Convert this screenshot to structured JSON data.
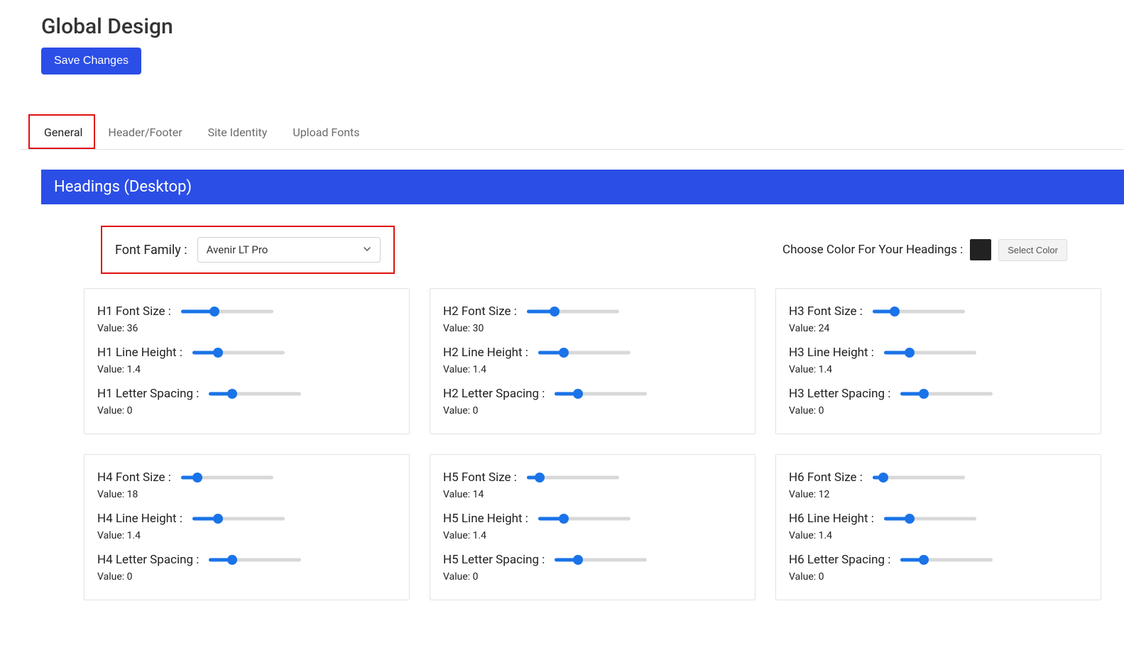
{
  "page": {
    "title": "Global Design",
    "save_label": "Save Changes"
  },
  "tabs": [
    {
      "label": "General",
      "active": true
    },
    {
      "label": "Header/Footer",
      "active": false
    },
    {
      "label": "Site Identity",
      "active": false
    },
    {
      "label": "Upload Fonts",
      "active": false
    }
  ],
  "section": {
    "title": "Headings (Desktop)",
    "font_family_label": "Font Family :",
    "font_family_value": "Avenir LT Pro",
    "color_label": "Choose Color For Your Headings :",
    "color_swatch": "#222222",
    "select_color_label": "Select Color"
  },
  "value_prefix": "Value: ",
  "headings": [
    {
      "key": "h1",
      "fontsize_label": "H1 Font Size :",
      "fontsize_value": "36",
      "fontsize_pct": 36,
      "lineheight_label": "H1 Line Height :",
      "lineheight_value": "1.4",
      "lineheight_pct": 28,
      "letterspacing_label": "H1 Letter Spacing :",
      "letterspacing_value": "0",
      "letterspacing_pct": 25
    },
    {
      "key": "h2",
      "fontsize_label": "H2 Font Size :",
      "fontsize_value": "30",
      "fontsize_pct": 30,
      "lineheight_label": "H2 Line Height :",
      "lineheight_value": "1.4",
      "lineheight_pct": 28,
      "letterspacing_label": "H2 Letter Spacing :",
      "letterspacing_value": "0",
      "letterspacing_pct": 25
    },
    {
      "key": "h3",
      "fontsize_label": "H3 Font Size :",
      "fontsize_value": "24",
      "fontsize_pct": 24,
      "lineheight_label": "H3 Line Height :",
      "lineheight_value": "1.4",
      "lineheight_pct": 28,
      "letterspacing_label": "H3 Letter Spacing :",
      "letterspacing_value": "0",
      "letterspacing_pct": 25
    },
    {
      "key": "h4",
      "fontsize_label": "H4 Font Size :",
      "fontsize_value": "18",
      "fontsize_pct": 18,
      "lineheight_label": "H4 Line Height :",
      "lineheight_value": "1.4",
      "lineheight_pct": 28,
      "letterspacing_label": "H4 Letter Spacing :",
      "letterspacing_value": "0",
      "letterspacing_pct": 25
    },
    {
      "key": "h5",
      "fontsize_label": "H5 Font Size :",
      "fontsize_value": "14",
      "fontsize_pct": 14,
      "lineheight_label": "H5 Line Height :",
      "lineheight_value": "1.4",
      "lineheight_pct": 28,
      "letterspacing_label": "H5 Letter Spacing :",
      "letterspacing_value": "0",
      "letterspacing_pct": 25
    },
    {
      "key": "h6",
      "fontsize_label": "H6 Font Size :",
      "fontsize_value": "12",
      "fontsize_pct": 12,
      "lineheight_label": "H6 Line Height :",
      "lineheight_value": "1.4",
      "lineheight_pct": 28,
      "letterspacing_label": "H6 Letter Spacing :",
      "letterspacing_value": "0",
      "letterspacing_pct": 25
    }
  ]
}
